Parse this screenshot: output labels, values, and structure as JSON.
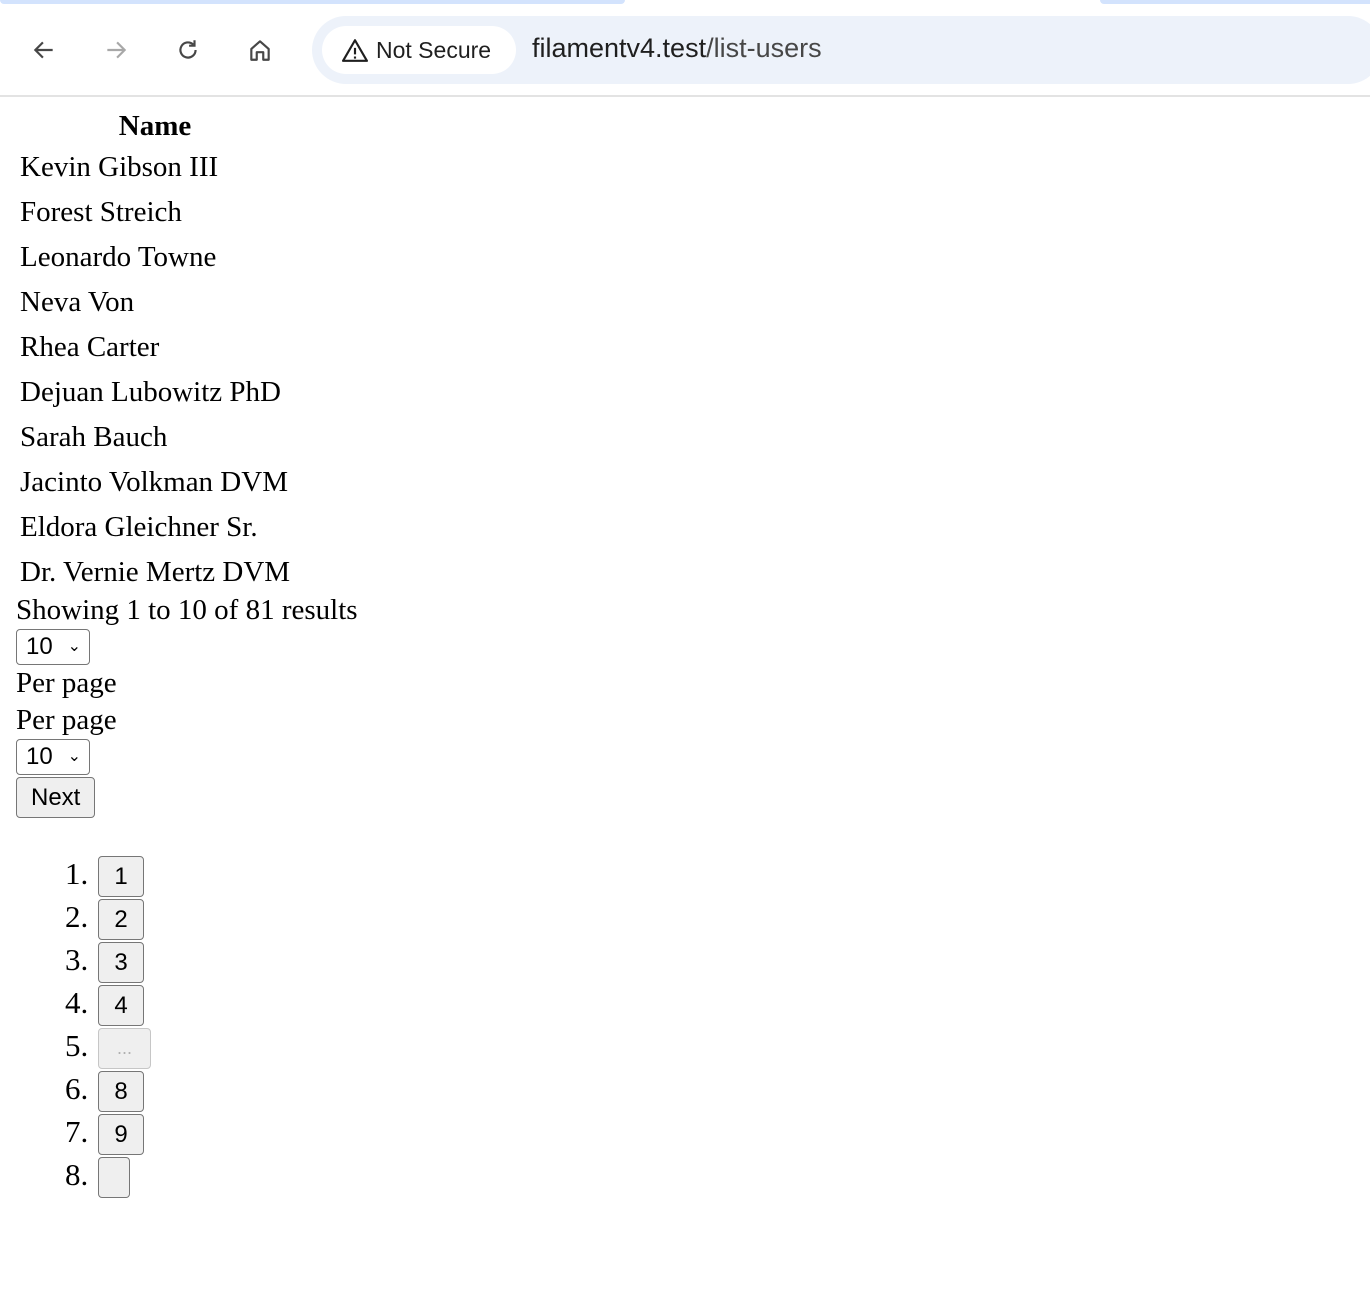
{
  "browser": {
    "security_label": "Not Secure",
    "url_host": "filamentv4.test",
    "url_path": "/list-users",
    "icons": [
      "back-icon",
      "forward-icon",
      "reload-icon",
      "home-icon",
      "warning-icon"
    ]
  },
  "table": {
    "header": "Name",
    "rows": [
      "Kevin Gibson III",
      "Forest Streich",
      "Leonardo Towne",
      "Neva Von",
      "Rhea Carter",
      "Dejuan Lubowitz PhD",
      "Sarah Bauch",
      "Jacinto Volkman DVM",
      "Eldora Gleichner Sr.",
      "Dr. Vernie Mertz DVM"
    ]
  },
  "pagination": {
    "summary": "Showing 1 to 10 of 81 results",
    "per_page_value_1": "10",
    "per_page_label_1": "Per page",
    "per_page_label_2": "Per page",
    "per_page_value_2": "10",
    "next_label": "Next",
    "pages": [
      "1",
      "2",
      "3",
      "4",
      "...",
      "8",
      "9",
      ""
    ]
  }
}
